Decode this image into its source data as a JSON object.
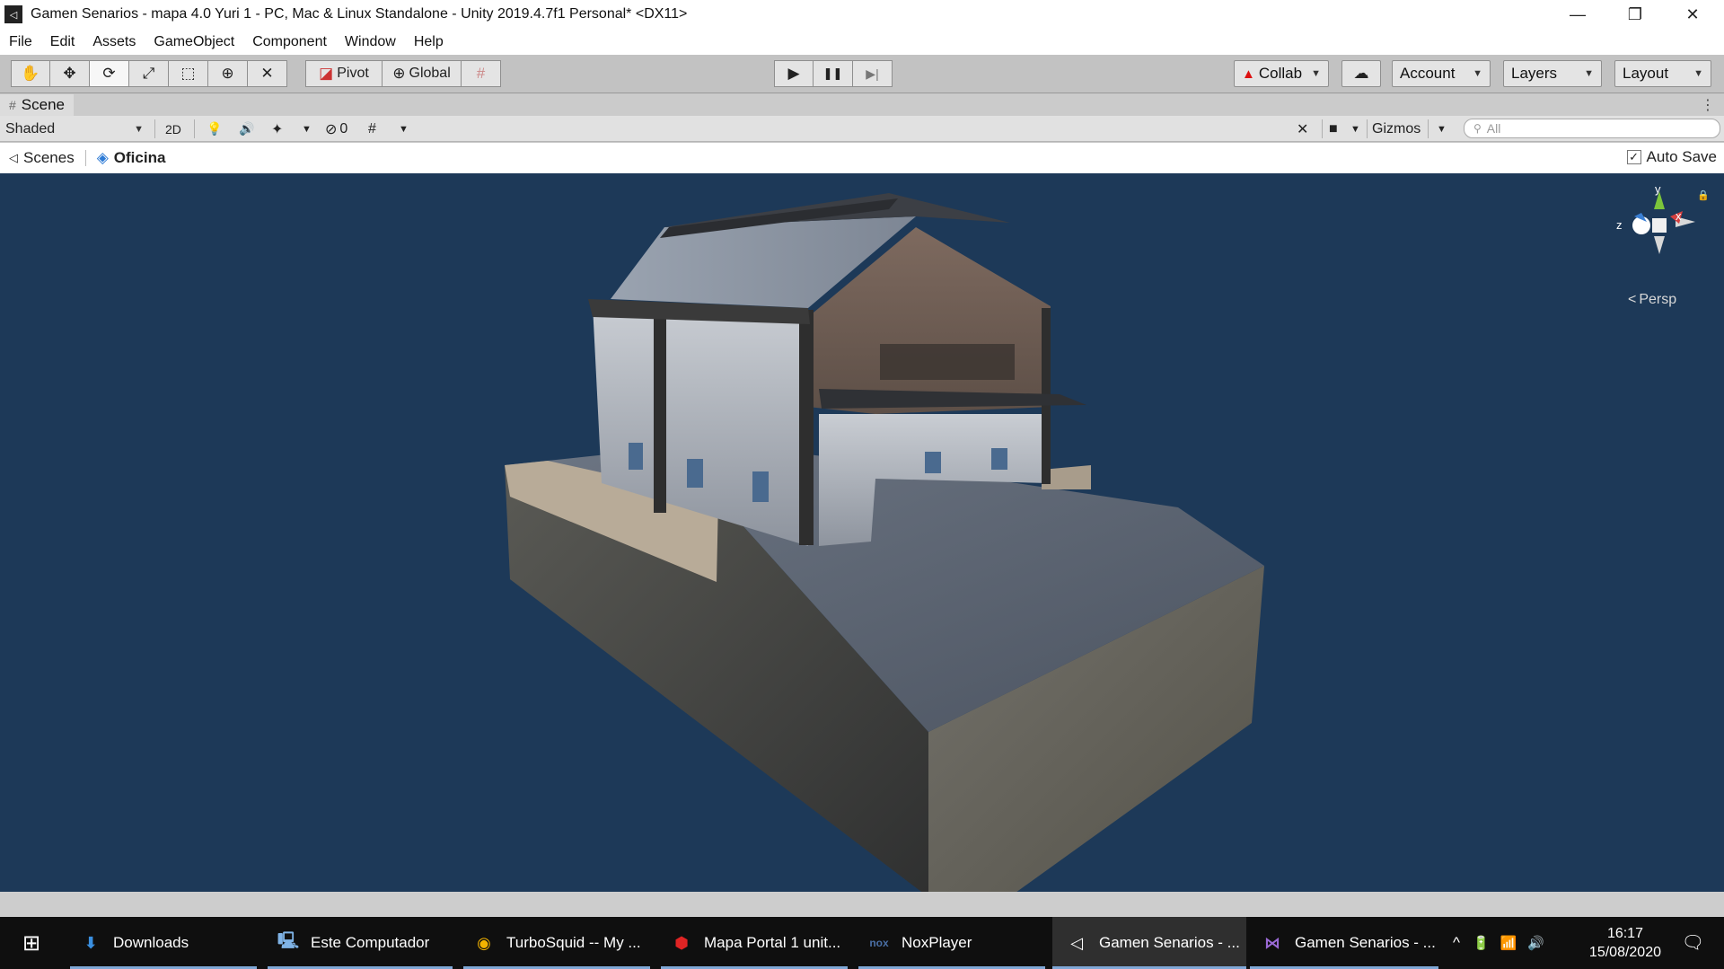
{
  "window": {
    "title": "Gamen Senarios - mapa 4.0 Yuri 1 - PC, Mac & Linux Standalone - Unity 2019.4.7f1 Personal* <DX11>",
    "app_icon": "unity-icon",
    "controls": {
      "minimize": "—",
      "restore": "❐",
      "close": "✕"
    }
  },
  "menu": [
    "File",
    "Edit",
    "Assets",
    "GameObject",
    "Component",
    "Window",
    "Help"
  ],
  "toolbar": {
    "tools": [
      "hand-tool-icon",
      "move-tool-icon",
      "rotate-tool-icon",
      "scale-tool-icon",
      "rect-tool-icon",
      "transform-tool-icon",
      "custom-tool-icon"
    ],
    "tool_glyphs": [
      "✋",
      "✥",
      "⟳",
      "⤢",
      "⬚",
      "⊕",
      "✕"
    ],
    "pivot_label": "Pivot",
    "global_label": "Global",
    "snap_glyph": "#",
    "play_glyph": "▶",
    "pause_glyph": "❚❚",
    "step_glyph": "▶|",
    "collab_label": "Collab",
    "collab_warning": "▲",
    "cloud_glyph": "☁",
    "account_label": "Account",
    "layers_label": "Layers",
    "layout_label": "Layout"
  },
  "scene_tab": {
    "label": "Scene",
    "icon_glyph": "#",
    "menu_glyph": "⋮"
  },
  "scene_toolbar": {
    "shading_mode": "Shaded",
    "mode_2d": "2D",
    "light_glyph": "💡",
    "audio_glyph": "🔊",
    "fx_glyph": "✦",
    "hidden_count": "0",
    "hidden_glyph": "⊘",
    "grid_glyph": "#",
    "tools_glyph": "✕",
    "camera_glyph": "■",
    "gizmos_label": "Gizmos",
    "search_placeholder": "All"
  },
  "breadcrumb": {
    "scenes_label": "Scenes",
    "current_scene": "Oficina",
    "back_glyph": "◁"
  },
  "auto_save": {
    "label": "Auto Save",
    "checked": true,
    "check_glyph": "✓"
  },
  "gizmo": {
    "x": "x",
    "y": "y",
    "z": "z",
    "projection": "Persp",
    "lock_glyph": "🔒"
  },
  "taskbar": {
    "start_glyph": "⊞",
    "tasks": [
      {
        "label": "Downloads",
        "icon": "download-arrow-icon",
        "glyph": "⬇",
        "color": "#3a8fe0"
      },
      {
        "label": "Este Computador",
        "icon": "computer-icon",
        "glyph": "🖳",
        "color": "#7fb3e6"
      },
      {
        "label": "TurboSquid -- My ...",
        "icon": "chrome-icon",
        "glyph": "◉",
        "color": "#f4b400"
      },
      {
        "label": "Mapa Portal 1 unit...",
        "icon": "pdf-icon",
        "glyph": "⬢",
        "color": "#e02424"
      },
      {
        "label": "NoxPlayer",
        "icon": "nox-icon",
        "glyph": "nox",
        "color": "#4a6fa5"
      },
      {
        "label": "Gamen Senarios - ...",
        "icon": "unity-icon",
        "glyph": "◁",
        "color": "#ffffff"
      },
      {
        "label": "Gamen Senarios - ...",
        "icon": "visual-studio-icon",
        "glyph": "⋈",
        "color": "#9b6ad6"
      }
    ],
    "tray_glyphs": [
      "^",
      "🔋",
      "📶",
      "🔊"
    ],
    "time": "16:17",
    "date": "15/08/2020",
    "notification_glyph": "🗨"
  }
}
